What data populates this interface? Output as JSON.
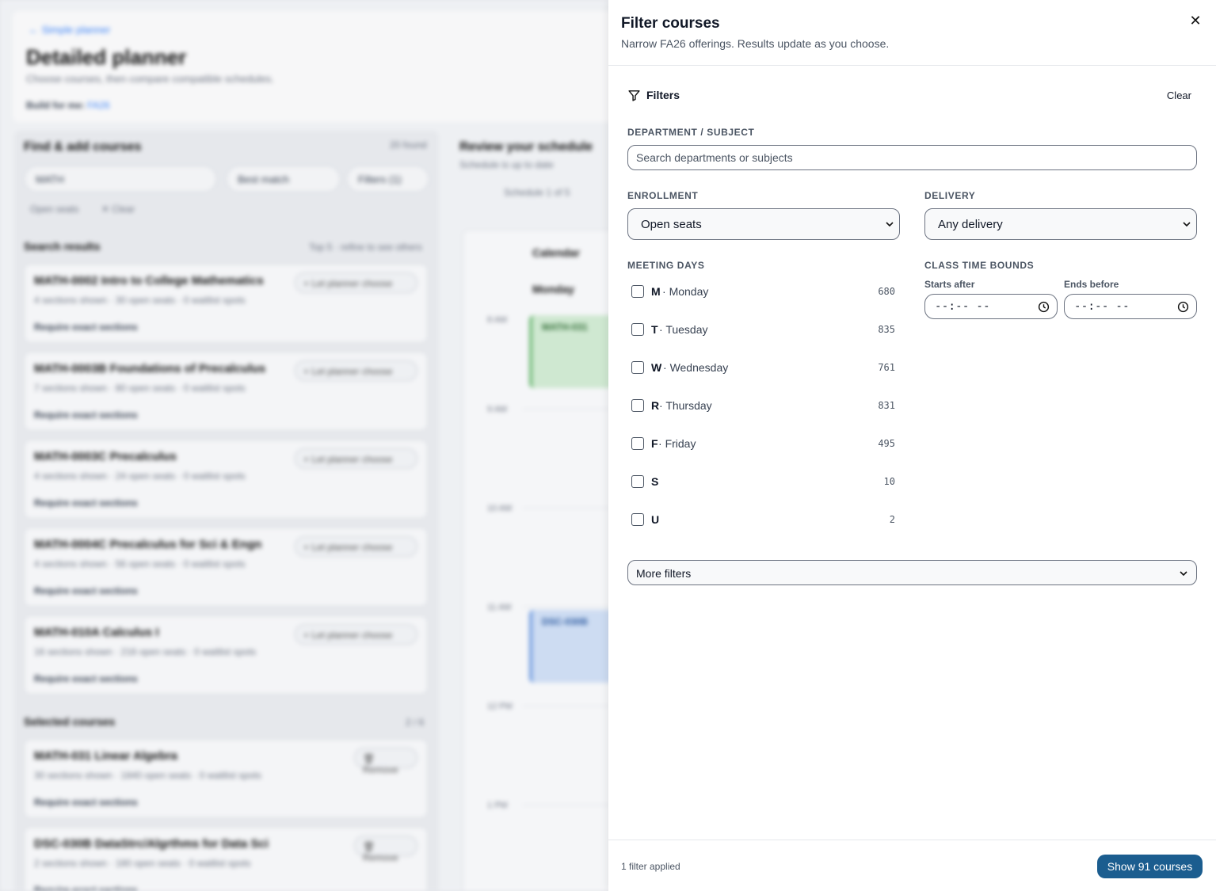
{
  "background": {
    "back_link": "← Simple planner",
    "title": "Detailed planner",
    "subtitle": "Choose courses, then compare compatible schedules.",
    "build_label": "Build for me:",
    "build_value": "FA26",
    "find_heading": "Find & add courses",
    "found_count": "20 found",
    "search_value": "MATH",
    "sort_value": "Best match",
    "filters_btn": "Filters (1)",
    "chip_open": "Open seats",
    "chip_clear": "✕ Clear",
    "results_heading": "Search results",
    "results_note": "Top 5 · refine to see others",
    "results": [
      {
        "title": "MATH-0002  Intro to College Mathematics",
        "meta": "4 sections shown · 30 open seats · 0 waitlist spots",
        "action": "+ Let planner choose",
        "require": "Require exact sections"
      },
      {
        "title": "MATH-0003B  Foundations of Precalculus",
        "meta": "7 sections shown · 80 open seats · 0 waitlist spots",
        "action": "+ Let planner choose",
        "require": "Require exact sections"
      },
      {
        "title": "MATH-0003C  Precalculus",
        "meta": "4 sections shown · 24 open seats · 0 waitlist spots",
        "action": "+ Let planner choose",
        "require": "Require exact sections"
      },
      {
        "title": "MATH-0004C  Precalculus for Sci & Engn",
        "meta": "4 sections shown · 56 open seats · 0 waitlist spots",
        "action": "+ Let planner choose",
        "require": "Require exact sections"
      },
      {
        "title": "MATH-010A  Calculus I",
        "meta": "16 sections shown · 216 open seats · 0 waitlist spots",
        "action": "+ Let planner choose",
        "require": "Require exact sections"
      }
    ],
    "selected_heading": "Selected courses",
    "selected_count": "2 / 6",
    "selected": [
      {
        "title": "MATH-031  Linear Algebra",
        "meta": "30 sections shown · 1840 open seats · 0 waitlist spots",
        "action": "🗑 Remove",
        "require": "Require exact sections"
      },
      {
        "title": "DSC-030B  DataStrc/Algrthms for Data Sci",
        "meta": "2 sections shown · 180 open seats · 0 waitlist spots",
        "action": "🗑 Remove",
        "require": "Require exact sections"
      }
    ],
    "review_heading": "Review your schedule",
    "review_sub": "Schedule is up to date",
    "schedule_nav": "Schedule 1 of 5",
    "calendar_tab": "Calendar",
    "day_header": "Monday",
    "times": [
      "8 AM",
      "9 AM",
      "10 AM",
      "11 AM",
      "12 PM",
      "1 PM"
    ],
    "event_green": "MATH-031",
    "event_blue": "DSC-030B"
  },
  "drawer": {
    "title": "Filter courses",
    "subtitle": "Narrow FA26 offerings. Results update as you choose.",
    "close_icon": "close-icon",
    "filters_label": "Filters",
    "clear_label": "Clear",
    "department": {
      "label": "DEPARTMENT / SUBJECT",
      "placeholder": "Search departments or subjects",
      "value": ""
    },
    "enrollment": {
      "label": "ENROLLMENT",
      "selected": "Open seats"
    },
    "delivery": {
      "label": "DELIVERY",
      "selected": "Any delivery"
    },
    "meeting_days": {
      "label": "MEETING DAYS",
      "days": [
        {
          "letter": "M",
          "name": "Monday",
          "count": "680",
          "checked": false
        },
        {
          "letter": "T",
          "name": "Tuesday",
          "count": "835",
          "checked": false
        },
        {
          "letter": "W",
          "name": "Wednesday",
          "count": "761",
          "checked": false
        },
        {
          "letter": "R",
          "name": "Thursday",
          "count": "831",
          "checked": false
        },
        {
          "letter": "F",
          "name": "Friday",
          "count": "495",
          "checked": false
        },
        {
          "letter": "S",
          "name": "",
          "count": "10",
          "checked": false
        },
        {
          "letter": "U",
          "name": "",
          "count": "2",
          "checked": false
        }
      ]
    },
    "time_bounds": {
      "label": "CLASS TIME BOUNDS",
      "starts_after_label": "Starts after",
      "starts_after_value": "--:-- --",
      "ends_before_label": "Ends before",
      "ends_before_value": "--:-- --"
    },
    "more_filters_label": "More filters",
    "footer": {
      "applied_text": "1 filter applied",
      "show_button": "Show 91 courses"
    }
  },
  "colors": {
    "primary_button": "#1b5d8f",
    "overlay_bg": "#e5e7eb"
  }
}
